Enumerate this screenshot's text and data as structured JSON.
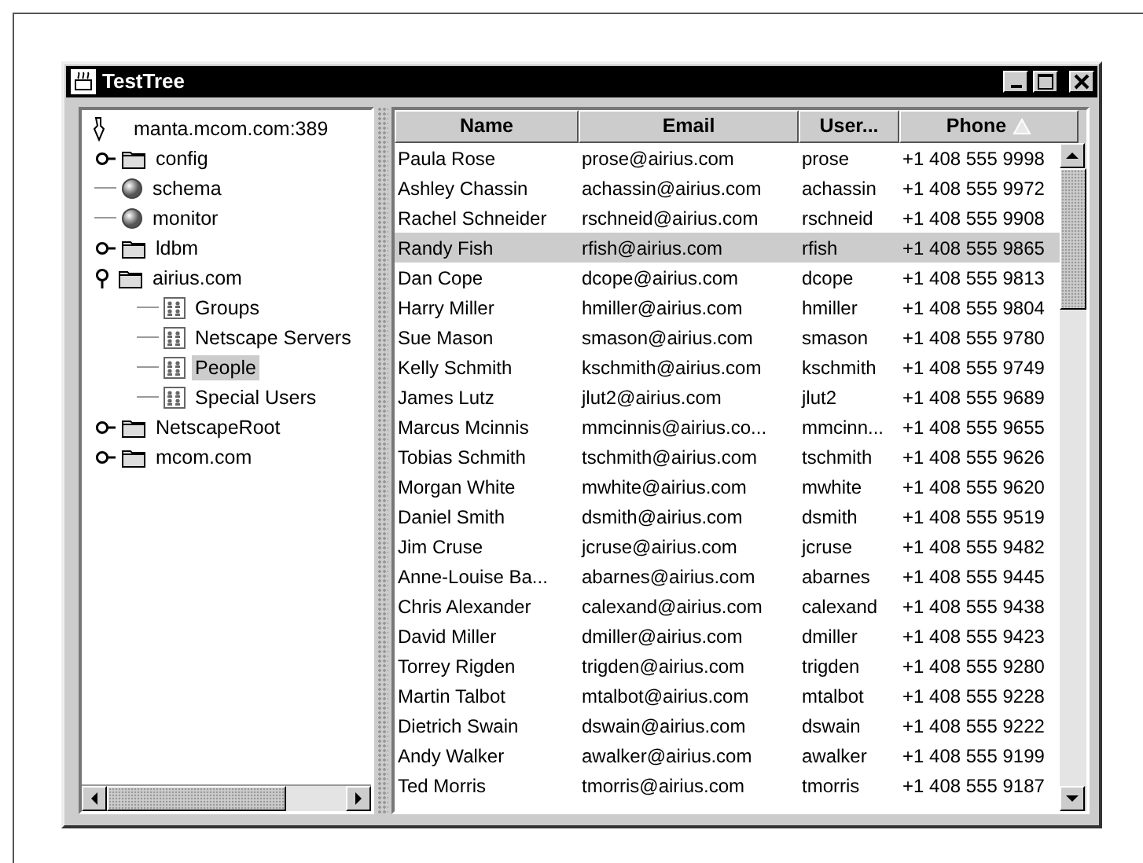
{
  "window": {
    "title": "TestTree"
  },
  "tree": {
    "label": "manta.mcom.com:389",
    "kind": "root",
    "selected": false,
    "children": [
      {
        "label": "config",
        "kind": "folder",
        "expanded": false,
        "selected": false
      },
      {
        "label": "schema",
        "kind": "server",
        "selected": false
      },
      {
        "label": "monitor",
        "kind": "server",
        "selected": false
      },
      {
        "label": "ldbm",
        "kind": "folder",
        "expanded": false,
        "selected": false
      },
      {
        "label": "airius.com",
        "kind": "folder",
        "expanded": true,
        "selected": false,
        "children": [
          {
            "label": "Groups",
            "kind": "group",
            "selected": false
          },
          {
            "label": "Netscape Servers",
            "kind": "group",
            "selected": false
          },
          {
            "label": "People",
            "kind": "group",
            "selected": true
          },
          {
            "label": "Special Users",
            "kind": "group",
            "selected": false
          }
        ]
      },
      {
        "label": "NetscapeRoot",
        "kind": "folder",
        "expanded": false,
        "selected": false
      },
      {
        "label": "mcom.com",
        "kind": "folder",
        "expanded": false,
        "selected": false
      }
    ]
  },
  "table": {
    "columns": [
      {
        "label": "Name",
        "sorted": false
      },
      {
        "label": "Email",
        "sorted": false
      },
      {
        "label": "User...",
        "sorted": false
      },
      {
        "label": "Phone",
        "sorted": true
      }
    ],
    "rows": [
      {
        "cells": [
          "Paula Rose",
          "prose@airius.com",
          "prose",
          "+1 408 555 9998"
        ],
        "selected": false
      },
      {
        "cells": [
          "Ashley Chassin",
          "achassin@airius.com",
          "achassin",
          "+1 408 555 9972"
        ],
        "selected": false
      },
      {
        "cells": [
          "Rachel Schneider",
          "rschneid@airius.com",
          "rschneid",
          "+1 408 555 9908"
        ],
        "selected": false
      },
      {
        "cells": [
          "Randy Fish",
          "rfish@airius.com",
          "rfish",
          "+1 408 555 9865"
        ],
        "selected": true
      },
      {
        "cells": [
          "Dan Cope",
          "dcope@airius.com",
          "dcope",
          "+1 408 555 9813"
        ],
        "selected": false
      },
      {
        "cells": [
          "Harry Miller",
          "hmiller@airius.com",
          "hmiller",
          "+1 408 555 9804"
        ],
        "selected": false
      },
      {
        "cells": [
          "Sue Mason",
          "smason@airius.com",
          "smason",
          "+1 408 555 9780"
        ],
        "selected": false
      },
      {
        "cells": [
          "Kelly Schmith",
          "kschmith@airius.com",
          "kschmith",
          "+1 408 555 9749"
        ],
        "selected": false
      },
      {
        "cells": [
          "James Lutz",
          "jlut2@airius.com",
          "jlut2",
          "+1 408 555 9689"
        ],
        "selected": false
      },
      {
        "cells": [
          "Marcus Mcinnis",
          "mmcinnis@airius.co...",
          "mmcinn...",
          "+1 408 555 9655"
        ],
        "selected": false
      },
      {
        "cells": [
          "Tobias Schmith",
          "tschmith@airius.com",
          "tschmith",
          "+1 408 555 9626"
        ],
        "selected": false
      },
      {
        "cells": [
          "Morgan White",
          "mwhite@airius.com",
          "mwhite",
          "+1 408 555 9620"
        ],
        "selected": false
      },
      {
        "cells": [
          "Daniel Smith",
          "dsmith@airius.com",
          "dsmith",
          "+1 408 555 9519"
        ],
        "selected": false
      },
      {
        "cells": [
          "Jim Cruse",
          "jcruse@airius.com",
          "jcruse",
          "+1 408 555 9482"
        ],
        "selected": false
      },
      {
        "cells": [
          "Anne-Louise Ba...",
          "abarnes@airius.com",
          "abarnes",
          "+1 408 555 9445"
        ],
        "selected": false
      },
      {
        "cells": [
          "Chris Alexander",
          "calexand@airius.com",
          "calexand",
          "+1 408 555 9438"
        ],
        "selected": false
      },
      {
        "cells": [
          "David Miller",
          "dmiller@airius.com",
          "dmiller",
          "+1 408 555 9423"
        ],
        "selected": false
      },
      {
        "cells": [
          "Torrey Rigden",
          "trigden@airius.com",
          "trigden",
          "+1 408 555 9280"
        ],
        "selected": false
      },
      {
        "cells": [
          "Martin Talbot",
          "mtalbot@airius.com",
          "mtalbot",
          "+1 408 555 9228"
        ],
        "selected": false
      },
      {
        "cells": [
          "Dietrich Swain",
          "dswain@airius.com",
          "dswain",
          "+1 408 555 9222"
        ],
        "selected": false
      },
      {
        "cells": [
          "Andy Walker",
          "awalker@airius.com",
          "awalker",
          "+1 408 555 9199"
        ],
        "selected": false
      },
      {
        "cells": [
          "Ted Morris",
          "tmorris@airius.com",
          "tmorris",
          "+1 408 555 9187"
        ],
        "selected": false
      }
    ]
  }
}
